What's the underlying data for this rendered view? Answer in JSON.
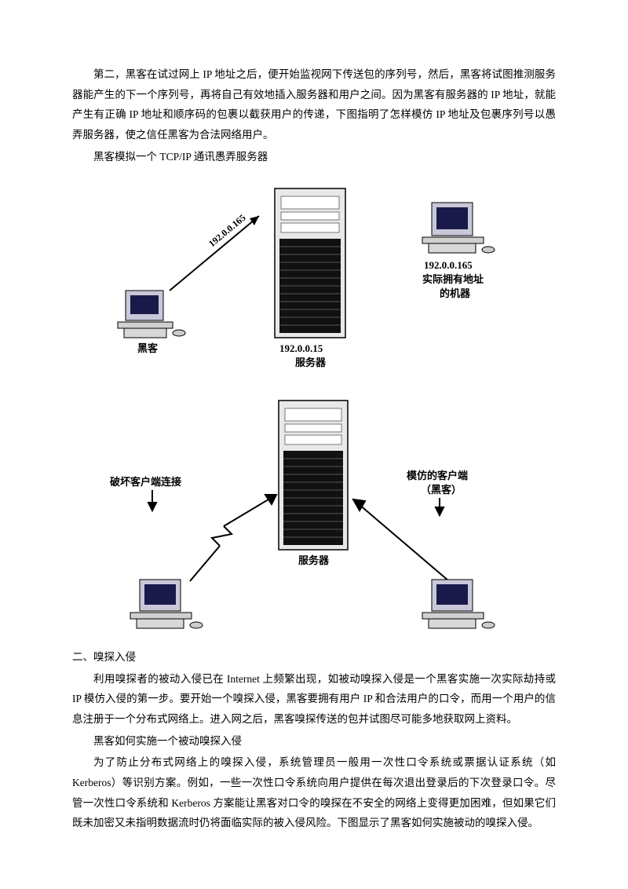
{
  "intro": {
    "p1": "第二，黑客在试过网上 IP 地址之后，便开始监视网下传送包的序列号，然后，黑客将试图推测服务器能产生的下一个序列号，再将自己有效地插入服务器和用户之间。因为黑客有服务器的 IP 地址，就能产生有正确 IP 地址和顺序码的包裹以截获用户的传递，下图指明了怎样模仿 IP 地址及包裹序列号以愚弄服务器，使之信任黑客为合法网络用户。",
    "p2": "黑客模拟一个 TCP/IP 通讯愚弄服务器"
  },
  "diagram1": {
    "hacker_label": "黑客",
    "hacker_ip_arrow": "192.0.0.165",
    "server_ip": "192.0.0.15",
    "server_label": "服务器",
    "real_ip": "192.0.0.165",
    "real_label1": "实际拥有地址",
    "real_label2": "的机器"
  },
  "diagram2": {
    "left_label": "破坏客户端连接",
    "center_label": "服务器",
    "right_label1": "模仿的客户端",
    "right_label2": "（黑客）"
  },
  "section2": {
    "heading": "二、嗅探入侵",
    "p1": "利用嗅探者的被动入侵已在 Internet 上频繁出现，如被动嗅探入侵是一个黑客实施一次实际劫持或 IP 模仿入侵的第一步。要开始一个嗅探入侵，黑客要拥有用户 IP 和合法用户的口令，而用一个用户的信息注册于一个分布式网络上。进入网之后，黑客嗅探传送的包并试图尽可能多地获取网上资料。",
    "p2": "黑客如何实施一个被动嗅探入侵",
    "p3": "为了防止分布式网络上的嗅探入侵，系统管理员一般用一次性口令系统或票据认证系统（如 Kerberos）等识别方案。例如，一些一次性口令系统向用户提供在每次退出登录后的下次登录口令。尽管一次性口令系统和 Kerberos 方案能让黑客对口令的嗅探在不安全的网络上变得更加困难，但如果它们既未加密又未指明数据流时仍将面临实际的被入侵风险。下图显示了黑客如何实施被动的嗅探入侵。"
  }
}
